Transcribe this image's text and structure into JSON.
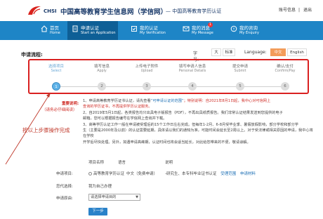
{
  "header": {
    "brand": "CHSI",
    "title": "中国高等教育学生信息网（学信网）",
    "subtitle": "— 中国高等教育学历认证",
    "links": [
      "账号信息",
      "退出"
    ]
  },
  "nav": [
    {
      "cn": "首页",
      "en": "Home",
      "icon": "home-icon"
    },
    {
      "cn": "申请认证",
      "en": "Start an Application",
      "icon": "document-icon",
      "active": true
    },
    {
      "cn": "我的认证",
      "en": "My Verification",
      "icon": "verification-icon"
    },
    {
      "cn": "我的消息",
      "en": "My Message",
      "icon": "message-icon",
      "badge": "1"
    },
    {
      "cn": "我的咨询",
      "en": "My Enquiry",
      "icon": "enquiry-icon"
    }
  ],
  "flow": {
    "title": "申请流程:",
    "font_label": "字号:",
    "font_sizes": [
      "大",
      "标准"
    ],
    "language_label": "Language:",
    "languages": [
      "中文",
      "English"
    ],
    "active_language": "中文"
  },
  "steps": [
    {
      "cn": "选择项目",
      "en": "Select",
      "num": "1",
      "current": true
    },
    {
      "cn": "填写信息",
      "en": "Apply",
      "num": "2"
    },
    {
      "cn": "上传电子附件",
      "en": "Upload",
      "num": "3"
    },
    {
      "cn": "填写申请人信息",
      "en": "Personal Details",
      "num": "4"
    },
    {
      "cn": "提交申请",
      "en": "Submit",
      "num": "5"
    },
    {
      "cn": "确认/支付",
      "en": "Confirm/Pay",
      "num": "6"
    }
  ],
  "annotation": "按以上步骤操作完成",
  "notes": {
    "label": "重要说明:",
    "label_sub": "（请务必仔细阅读）",
    "line1_a": "1、申请高等教育学历证书认证，请先查看",
    "line1_link": "“可申请认证的范围”",
    "line1_b": "；特别说明：自2021年8月1日起，我中心对可信网上",
    "line1_c": "查询的学历证书，不再提供学历认证服务。",
    "line2": "2、自2019年5月1日起，各类报告均只出具电子版报告（PDF），不再出具纸质报告。我们非常认证结果发送到您提供的电子",
    "line2_b": "邮箱，您可以根据报告编号在学信网上查询并下载。",
    "line3": "3、高等学历认证工作一般在申请被受理后的15个工作日左右完成。但每年1-2月、6-8月受毕业季、暑假放假影响，部分学校和部分学",
    "line3_b": "生（主要是2000年及以前）的认证需要延期，具体请以我们的通知为准，可能时间会延长至2周以上。对于受法律或相关原因的申请，我中心将在学校",
    "line3_c": "开学后尽快处理。另外，如遇申请高峰期，认证时间也将会适当延长，对此给您带来的不便，敬请谅解。"
  },
  "form": {
    "col_item": "项目名称",
    "col_lang": "语言",
    "col_desc": "说明",
    "apply_label": "申请项目:",
    "apply_item": "高等教育学历认证",
    "apply_lang": "中文（免费申请）",
    "apply_desc": "-研究生、本专科毕业证书认证",
    "apply_link1": "受理范围",
    "apply_link2": "申请材料",
    "who_label": "您代选择:",
    "who_value": "我为自己办理",
    "from_label": "申请原由:",
    "from_select": "请选择申请目的",
    "next": "下一步"
  },
  "colors": {
    "nav_bg": "#1e85c6",
    "nav_active": "#0e5f96",
    "highlight_red": "#d92020",
    "accent_orange": "#f39c5a",
    "link_blue": "#1c6fb5"
  }
}
